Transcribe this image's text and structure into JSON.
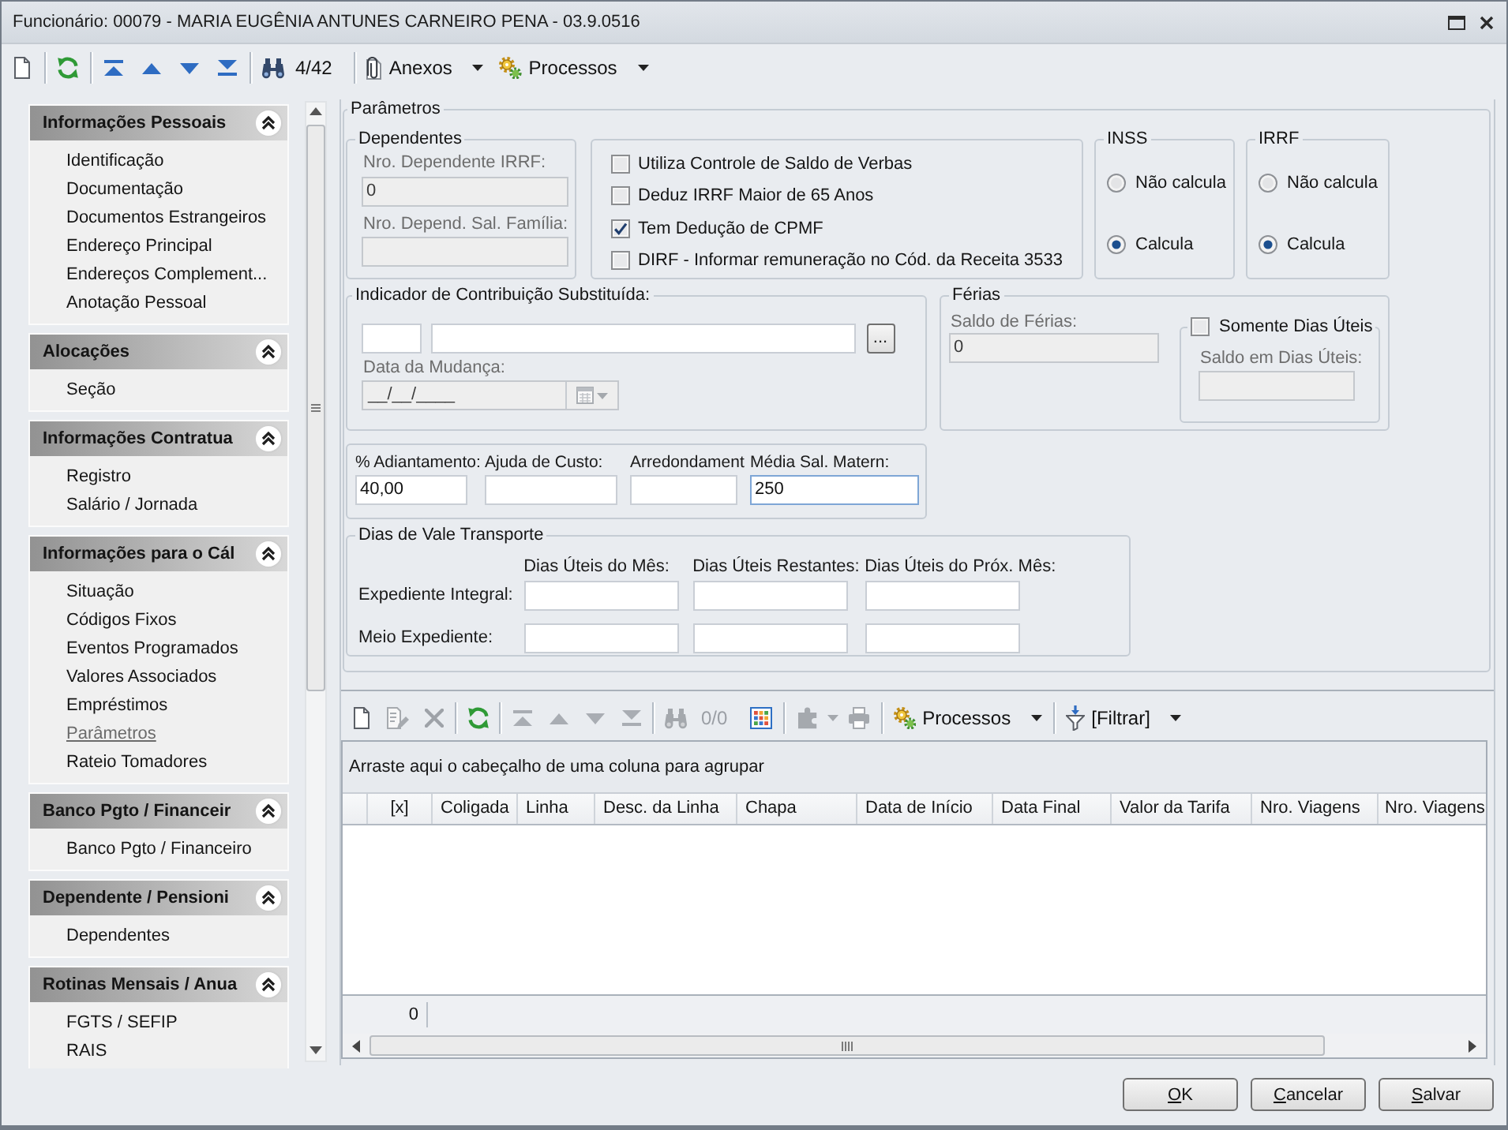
{
  "window": {
    "title": "Funcionário: 00079 - MARIA EUGÊNIA ANTUNES CARNEIRO PENA - 03.9.0516"
  },
  "toolbar": {
    "groups": [
      [
        {
          "kind": "new",
          "disabled": false
        }
      ],
      [
        {
          "kind": "refresh",
          "disabled": false
        }
      ],
      [
        {
          "kind": "first",
          "disabled": false
        },
        {
          "kind": "previous",
          "disabled": false
        },
        {
          "kind": "next",
          "disabled": false
        },
        {
          "kind": "last",
          "disabled": false
        }
      ],
      [
        {
          "kind": "find",
          "disabled": false
        },
        {
          "kind": "counter",
          "text": "4/42",
          "disabled": false
        }
      ],
      [
        {
          "kind": "attachments",
          "label": "Anexos",
          "dropdown": true,
          "disabled": false
        },
        {
          "kind": "processes",
          "label": "Processos",
          "dropdown": true,
          "disabled": false
        }
      ]
    ]
  },
  "sidebar": {
    "groups": [
      {
        "title": "Informações Pessoais",
        "expanded": true,
        "items": [
          {
            "label": "Identificação",
            "selected": false
          },
          {
            "label": "Documentação",
            "selected": false
          },
          {
            "label": "Documentos Estrangeiros",
            "selected": false
          },
          {
            "label": "Endereço Principal",
            "selected": false
          },
          {
            "label": "Endereços Complement...",
            "selected": false
          },
          {
            "label": "Anotação Pessoal",
            "selected": false
          }
        ]
      },
      {
        "title": "Alocações",
        "expanded": true,
        "items": [
          {
            "label": "Seção",
            "selected": false
          }
        ]
      },
      {
        "title": "Informações Contratua",
        "expanded": true,
        "items": [
          {
            "label": "Registro",
            "selected": false
          },
          {
            "label": "Salário / Jornada",
            "selected": false
          }
        ]
      },
      {
        "title": "Informações para o Cál",
        "expanded": true,
        "items": [
          {
            "label": "Situação",
            "selected": false
          },
          {
            "label": "Códigos Fixos",
            "selected": false
          },
          {
            "label": "Eventos Programados",
            "selected": false
          },
          {
            "label": "Valores Associados",
            "selected": false
          },
          {
            "label": "Empréstimos",
            "selected": false
          },
          {
            "label": "Parâmetros",
            "selected": true
          },
          {
            "label": "Rateio Tomadores",
            "selected": false
          }
        ]
      },
      {
        "title": "Banco Pgto / Financeir",
        "expanded": true,
        "items": [
          {
            "label": "Banco Pgto / Financeiro",
            "selected": false
          }
        ]
      },
      {
        "title": "Dependente / Pensioni",
        "expanded": true,
        "items": [
          {
            "label": "Dependentes",
            "selected": false
          }
        ]
      },
      {
        "title": "Rotinas Mensais / Anua",
        "expanded": true,
        "items": [
          {
            "label": "FGTS / SEFIP",
            "selected": false
          },
          {
            "label": "RAIS",
            "selected": false
          }
        ]
      }
    ]
  },
  "parameters": {
    "title": "Parâmetros",
    "dependents": {
      "title": "Dependentes",
      "fields": [
        {
          "label": "Nro. Dependente IRRF:",
          "value": "0",
          "disabled": true
        },
        {
          "label": "Nro. Depend. Sal. Família:",
          "disabled": true
        }
      ]
    },
    "flags": [
      {
        "label": "Utiliza Controle de Saldo de Verbas",
        "checked": false
      },
      {
        "label": "Deduz IRRF Maior de 65 Anos",
        "checked": false
      },
      {
        "label": "Tem Dedução de CPMF",
        "checked": true
      },
      {
        "label": "DIRF - Informar remuneração no Cód. da Receita 3533",
        "checked": false
      }
    ],
    "inss": {
      "title": "INSS",
      "options": [
        {
          "label": "Não calcula",
          "selected": false
        },
        {
          "label": "Calcula",
          "selected": true
        }
      ]
    },
    "irrf": {
      "title": "IRRF",
      "options": [
        {
          "label": "Não calcula",
          "selected": false
        },
        {
          "label": "Calcula",
          "selected": true
        }
      ]
    },
    "substitution": {
      "title": "Indicador de Contribuição Substituída:",
      "browse_button": "...",
      "date": {
        "label": "Data da Mudança:",
        "value": "__/__/____",
        "disabled": true
      }
    },
    "vacation": {
      "title": "Férias",
      "balance": {
        "label": "Saldo de Férias:",
        "value": "0",
        "disabled": true
      },
      "business_days": {
        "label": "Somente Dias Úteis",
        "checked": false,
        "balance": {
          "label": "Saldo em Dias Úteis:",
          "disabled": true
        }
      }
    },
    "amounts": [
      {
        "label": "% Adiantamento:",
        "value": "40,00",
        "focused": false
      },
      {
        "label": "Ajuda de Custo:",
        "focused": false
      },
      {
        "label": "Arredondament",
        "focused": false
      },
      {
        "label": "Média Sal. Matern:",
        "value": "250",
        "focused": true
      }
    ],
    "transport": {
      "title": "Dias de Vale Transporte",
      "columns": [
        "Dias Úteis do Mês:",
        "Dias Úteis Restantes:",
        "Dias Úteis do Próx. Mês:"
      ],
      "rows": [
        "Expediente Integral:",
        "Meio Expediente:"
      ]
    }
  },
  "grid": {
    "toolbar": {
      "groups": [
        [
          {
            "kind": "new",
            "disabled": false
          },
          {
            "kind": "edit",
            "disabled": true
          },
          {
            "kind": "delete",
            "disabled": true
          }
        ],
        [
          {
            "kind": "refresh",
            "disabled": false
          }
        ],
        [
          {
            "kind": "first",
            "disabled": true
          },
          {
            "kind": "previous",
            "disabled": true
          },
          {
            "kind": "next",
            "disabled": true
          },
          {
            "kind": "last",
            "disabled": true
          }
        ],
        [
          {
            "kind": "find",
            "disabled": true
          },
          {
            "kind": "counter",
            "text": "0/0",
            "disabled": true
          },
          {
            "kind": "grid",
            "disabled": false
          }
        ],
        [
          {
            "kind": "puzzle",
            "dropdown": true,
            "disabled": true
          },
          {
            "kind": "print",
            "disabled": true
          }
        ],
        [
          {
            "kind": "processes",
            "label": "Processos",
            "dropdown": true,
            "disabled": false
          }
        ],
        [
          {
            "kind": "filter",
            "label": "[Filtrar]",
            "dropdown": true,
            "disabled": false
          }
        ]
      ]
    },
    "group_hint": "Arraste aqui o cabeçalho de uma coluna para agrupar",
    "columns": [
      "[x]",
      "Coligada",
      "Linha",
      "Desc. da Linha",
      "Chapa",
      "Data de Início",
      "Data Final",
      "Valor da Tarifa",
      "Nro. Viagens",
      "Nro. Viagens"
    ],
    "footer_count": "0"
  },
  "buttons": [
    "OK",
    "Cancelar",
    "Salvar"
  ]
}
